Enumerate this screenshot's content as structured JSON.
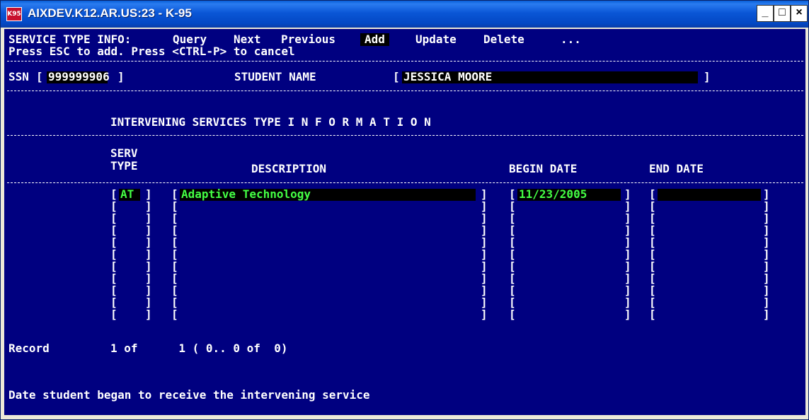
{
  "window": {
    "title": "AIXDEV.K12.AR.US:23 - K-95",
    "icon_label": "K95",
    "minimize": "_",
    "maximize": "□",
    "close": "×"
  },
  "menu": {
    "label": "SERVICE TYPE INFO:",
    "items": [
      "Query",
      "Next",
      "Previous",
      "Add",
      "Update",
      "Delete",
      "..."
    ],
    "active": "Add",
    "hint": "Press ESC to add. Press <CTRL-P> to cancel"
  },
  "student": {
    "ssn_label": "SSN",
    "ssn_value": "999999906",
    "name_label": "STUDENT NAME",
    "name_value": "JESSICA MOORE"
  },
  "section_title": "INTERVENING SERVICES TYPE I N F O R M A T I O N",
  "columns": {
    "serv_type_1": "SERV",
    "serv_type_2": "TYPE",
    "description": "DESCRIPTION",
    "begin_date": "BEGIN DATE",
    "end_date": "END DATE"
  },
  "rows": [
    {
      "type": "AT",
      "description": "Adaptive Technology",
      "begin_date": "11/23/2005",
      "end_date": ""
    },
    {
      "type": "",
      "description": "",
      "begin_date": "",
      "end_date": ""
    },
    {
      "type": "",
      "description": "",
      "begin_date": "",
      "end_date": ""
    },
    {
      "type": "",
      "description": "",
      "begin_date": "",
      "end_date": ""
    },
    {
      "type": "",
      "description": "",
      "begin_date": "",
      "end_date": ""
    },
    {
      "type": "",
      "description": "",
      "begin_date": "",
      "end_date": ""
    },
    {
      "type": "",
      "description": "",
      "begin_date": "",
      "end_date": ""
    },
    {
      "type": "",
      "description": "",
      "begin_date": "",
      "end_date": ""
    },
    {
      "type": "",
      "description": "",
      "begin_date": "",
      "end_date": ""
    },
    {
      "type": "",
      "description": "",
      "begin_date": "",
      "end_date": ""
    },
    {
      "type": "",
      "description": "",
      "begin_date": "",
      "end_date": ""
    }
  ],
  "record": {
    "label": "Record",
    "text": "1 of      1 ( 0.. 0 of  0)"
  },
  "status_message": "Date student began to receive the intervening service",
  "colors": {
    "terminal_bg": "#000080",
    "text": "#ffffff",
    "field_value": "#44ff44",
    "titlebar": "#0a56d6"
  }
}
